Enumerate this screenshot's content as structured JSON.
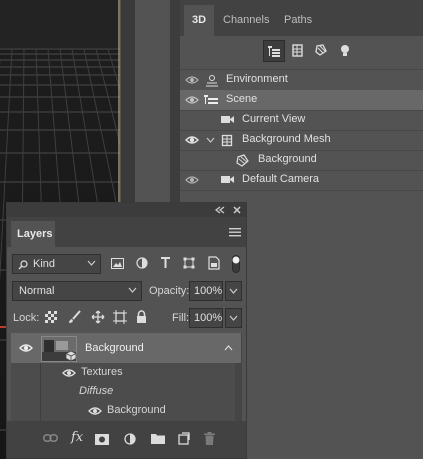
{
  "panel3d": {
    "tabs": [
      "3D",
      "Channels",
      "Paths"
    ],
    "active_tab": "3D",
    "scene_items": [
      {
        "label": "Environment",
        "icon": "environment-icon",
        "eye": true,
        "selected": false
      },
      {
        "label": "Scene",
        "icon": "scene-icon",
        "eye": true,
        "selected": true
      },
      {
        "label": "Current View",
        "icon": "camera-icon",
        "eye": false,
        "selected": false
      },
      {
        "label": "Background Mesh",
        "icon": "mesh-icon",
        "eye": true,
        "selected": false,
        "expanded": true
      },
      {
        "label": "Background",
        "icon": "material-icon",
        "eye": true,
        "selected": false
      },
      {
        "label": "Default Camera",
        "icon": "camera-icon",
        "eye": true,
        "selected": false
      }
    ]
  },
  "layers": {
    "tab_label": "Layers",
    "filter": {
      "kind_label": "Kind"
    },
    "blend_mode": "Normal",
    "opacity_label": "Opacity:",
    "opacity_value": "100%",
    "lock_label": "Lock:",
    "fill_label": "Fill:",
    "fill_value": "100%",
    "layer_name": "Background",
    "textures_label": "Textures",
    "diffuse_label": "Diffuse",
    "diffuse_item": "Background"
  },
  "colors": {
    "panel_bg": "#535353",
    "tabbar_bg": "#424242",
    "selected_row": "#686868",
    "viewport_bg": "#1b1b1b"
  }
}
